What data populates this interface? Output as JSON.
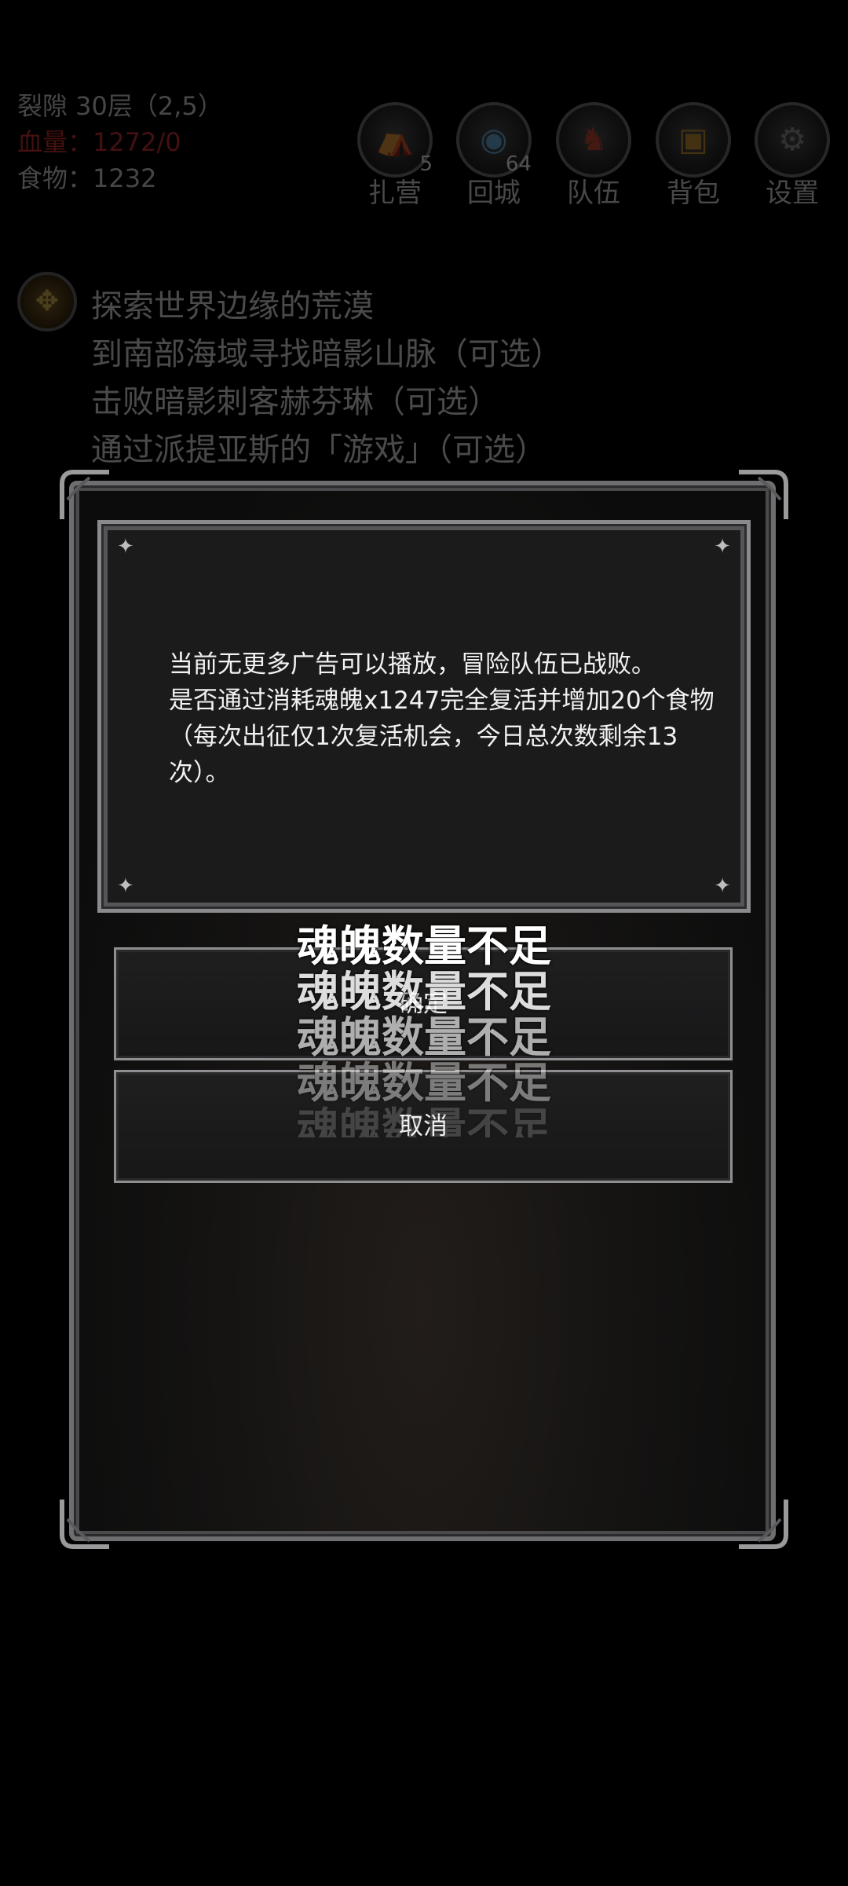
{
  "hud": {
    "location": "裂隙 30层（2,5）",
    "hp": "血量：1272/0",
    "food": "食物：1232",
    "nav": [
      {
        "label": "扎营",
        "icon": "camp-icon",
        "badge": "5"
      },
      {
        "label": "回城",
        "icon": "return-town-icon",
        "badge": "64"
      },
      {
        "label": "队伍",
        "icon": "team-icon",
        "badge": ""
      },
      {
        "label": "背包",
        "icon": "backpack-icon",
        "badge": ""
      },
      {
        "label": "设置",
        "icon": "gear-icon",
        "badge": ""
      }
    ],
    "quest_icon": "compass-icon",
    "quests": [
      "探索世界边缘的荒漠",
      "到南部海域寻找暗影山脉（可选）",
      "击败暗影刺客赫芬琳（可选）",
      "通过派提亚斯的「游戏」（可选）"
    ]
  },
  "dialog": {
    "line1": "当前无更多广告可以播放，冒险队伍已战败。",
    "line2": "是否通过消耗魂魄x1247完全复活并增加20个食物（每次出征仅1次复活机会，今日总次数剩余13次）。",
    "confirm_label": "确定",
    "cancel_label": "取消"
  },
  "toasts": [
    "魂魄数量不足",
    "魂魄数量不足",
    "魂魄数量不足",
    "魂魄数量不足",
    "魂魄数量不足"
  ],
  "colors": {
    "hp": "#d23232",
    "frame": "#6e6e70",
    "panel": "#1b1b1c"
  }
}
